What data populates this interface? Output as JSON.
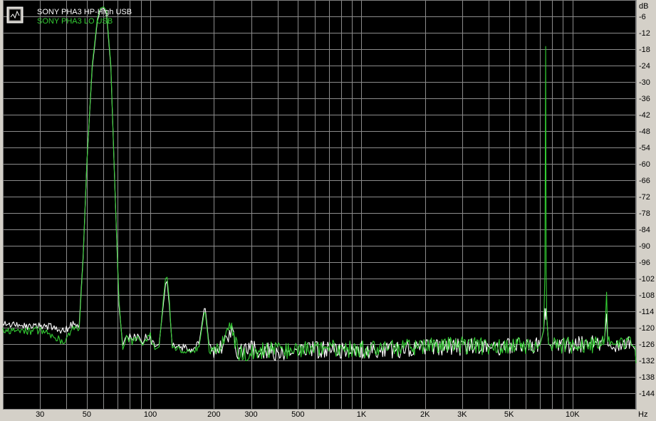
{
  "chart_data": {
    "type": "line",
    "title": "",
    "xlabel": "Hz",
    "ylabel": "dB",
    "x_scale": "log",
    "xlim": [
      20,
      20000
    ],
    "ylim": [
      -150,
      0
    ],
    "grid": true,
    "legend_position": "top-left",
    "x_ticks": [
      {
        "value": 30,
        "label": "30"
      },
      {
        "value": 50,
        "label": "50"
      },
      {
        "value": 100,
        "label": "100"
      },
      {
        "value": 200,
        "label": "200"
      },
      {
        "value": 300,
        "label": "300"
      },
      {
        "value": 500,
        "label": "500"
      },
      {
        "value": 1000,
        "label": "1K"
      },
      {
        "value": 2000,
        "label": "2K"
      },
      {
        "value": 3000,
        "label": "3K"
      },
      {
        "value": 5000,
        "label": "5K"
      },
      {
        "value": 10000,
        "label": "10K"
      }
    ],
    "x_grid_values": [
      20,
      30,
      40,
      50,
      60,
      70,
      80,
      90,
      100,
      200,
      300,
      400,
      500,
      600,
      700,
      800,
      900,
      1000,
      2000,
      3000,
      4000,
      5000,
      6000,
      7000,
      8000,
      9000,
      10000,
      20000
    ],
    "y_ticks": [
      -6,
      -12,
      -18,
      -24,
      -30,
      -36,
      -42,
      -48,
      -54,
      -60,
      -66,
      -72,
      -78,
      -84,
      -90,
      -96,
      -102,
      -108,
      -114,
      -120,
      -126,
      -132,
      -138,
      -144
    ],
    "colors": {
      "background": "#000000",
      "grid": "#8c8c8c",
      "frame": "#d4d0c8"
    },
    "series": [
      {
        "name": "SONY PHA3 HP-High USB",
        "color": "#ffffff",
        "points": [
          [
            20,
            -118.5
          ],
          [
            25,
            -119.5
          ],
          [
            30,
            -119
          ],
          [
            35,
            -120
          ],
          [
            38,
            -121.5
          ],
          [
            40,
            -120.5
          ],
          [
            43,
            -118.5
          ],
          [
            46,
            -119
          ],
          [
            48,
            -94
          ],
          [
            50,
            -60
          ],
          [
            53,
            -25
          ],
          [
            56,
            -8
          ],
          [
            58,
            -3.5
          ],
          [
            60,
            -3
          ],
          [
            62,
            -5
          ],
          [
            65,
            -25
          ],
          [
            68,
            -70
          ],
          [
            71,
            -112
          ],
          [
            74,
            -126.5
          ],
          [
            77,
            -122.5
          ],
          [
            82,
            -124
          ],
          [
            88,
            -123
          ],
          [
            92,
            -126
          ],
          [
            95,
            -123.5
          ],
          [
            100,
            -124
          ],
          [
            105,
            -127
          ],
          [
            110,
            -126
          ],
          [
            115,
            -112
          ],
          [
            118,
            -104
          ],
          [
            120,
            -103
          ],
          [
            123,
            -112
          ],
          [
            127,
            -127
          ],
          [
            140,
            -127
          ],
          [
            155,
            -128
          ],
          [
            170,
            -126
          ],
          [
            180,
            -113
          ],
          [
            182,
            -113
          ],
          [
            190,
            -127
          ],
          [
            200,
            -128
          ],
          [
            220,
            -126
          ],
          [
            240,
            -121
          ],
          [
            260,
            -129
          ],
          [
            300,
            -128
          ],
          [
            400,
            -129
          ],
          [
            500,
            -128
          ],
          [
            700,
            -128
          ],
          [
            1000,
            -128
          ],
          [
            1500,
            -128
          ],
          [
            2000,
            -127.5
          ],
          [
            3000,
            -127
          ],
          [
            4000,
            -127
          ],
          [
            5000,
            -127
          ],
          [
            6000,
            -126.5
          ],
          [
            7000,
            -126.5
          ],
          [
            7300,
            -121
          ],
          [
            7400,
            -113
          ],
          [
            7460,
            -117
          ],
          [
            7500,
            -113
          ],
          [
            7550,
            -116
          ],
          [
            7700,
            -126
          ],
          [
            8000,
            -127
          ],
          [
            10000,
            -126.5
          ],
          [
            13000,
            -126
          ],
          [
            14200,
            -124
          ],
          [
            14500,
            -115
          ],
          [
            14700,
            -124
          ],
          [
            16000,
            -126.5
          ],
          [
            18000,
            -125.5
          ],
          [
            19000,
            -126
          ],
          [
            19800,
            -128
          ],
          [
            20000,
            -132.5
          ]
        ]
      },
      {
        "name": "SONY PHA3 LO USB",
        "color": "#33cc33",
        "points": [
          [
            20,
            -121
          ],
          [
            25,
            -121.5
          ],
          [
            30,
            -121
          ],
          [
            35,
            -123
          ],
          [
            38,
            -125
          ],
          [
            40,
            -124
          ],
          [
            43,
            -120
          ],
          [
            46,
            -120.5
          ],
          [
            48,
            -95
          ],
          [
            50,
            -60
          ],
          [
            53,
            -24
          ],
          [
            56,
            -7
          ],
          [
            58,
            -3
          ],
          [
            60,
            -2.5
          ],
          [
            62,
            -4
          ],
          [
            65,
            -24
          ],
          [
            68,
            -70
          ],
          [
            71,
            -110
          ],
          [
            74,
            -128
          ],
          [
            77,
            -124
          ],
          [
            82,
            -125
          ],
          [
            88,
            -124
          ],
          [
            92,
            -126.5
          ],
          [
            95,
            -124
          ],
          [
            100,
            -123
          ],
          [
            105,
            -128
          ],
          [
            110,
            -127
          ],
          [
            115,
            -110
          ],
          [
            118,
            -102
          ],
          [
            120,
            -101.5
          ],
          [
            123,
            -110
          ],
          [
            127,
            -128
          ],
          [
            140,
            -128
          ],
          [
            155,
            -129
          ],
          [
            170,
            -127
          ],
          [
            180,
            -114.5
          ],
          [
            182,
            -114.5
          ],
          [
            190,
            -128
          ],
          [
            200,
            -129
          ],
          [
            220,
            -126
          ],
          [
            240,
            -119.5
          ],
          [
            260,
            -129
          ],
          [
            300,
            -129
          ],
          [
            400,
            -128
          ],
          [
            500,
            -128.5
          ],
          [
            700,
            -127.5
          ],
          [
            1000,
            -128
          ],
          [
            1500,
            -127.5
          ],
          [
            2000,
            -127
          ],
          [
            3000,
            -126.5
          ],
          [
            4000,
            -127
          ],
          [
            5000,
            -126.5
          ],
          [
            6000,
            -126.5
          ],
          [
            7000,
            -126.5
          ],
          [
            7300,
            -121
          ],
          [
            7400,
            -100
          ],
          [
            7460,
            -17
          ],
          [
            7500,
            -100
          ],
          [
            7550,
            -116
          ],
          [
            7700,
            -126
          ],
          [
            8000,
            -126.5
          ],
          [
            10000,
            -126.5
          ],
          [
            13000,
            -126
          ],
          [
            14200,
            -124
          ],
          [
            14500,
            -107
          ],
          [
            14700,
            -124
          ],
          [
            16000,
            -126.5
          ],
          [
            18000,
            -126
          ],
          [
            19000,
            -126.5
          ],
          [
            19800,
            -127
          ],
          [
            20000,
            -133
          ]
        ]
      }
    ]
  }
}
